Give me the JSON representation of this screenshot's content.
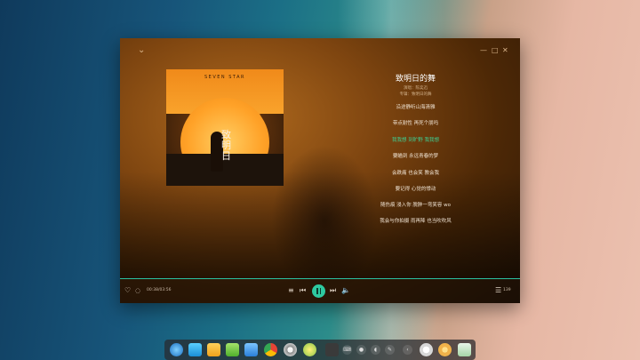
{
  "player": {
    "song_title": "致明日的舞",
    "singer": "演唱：陈奕迅",
    "album": "专辑：致明日的舞",
    "cover_text_top": "SEVEN STAR",
    "cover_text_vertical": "致明日",
    "lyrics": [
      "沿途静听山海清雅",
      "带点耐性 再死个朋吗",
      "我我想 到旷野 我我想",
      "要瞄到 永远青春的梦",
      "会跌痛 也会笑 教会我",
      "要记得 心觉的悸动",
      "随伤痕 浸入你 脱肿一弯笑容 wo",
      "我会与你拍摄 雨再降 也当吹吹风"
    ],
    "active_lyric_index": 2,
    "time": "00:38/03:56",
    "comment_count": "139"
  },
  "dock": {
    "apps": [
      "launcher-icon",
      "multitask-icon",
      "file-manager-icon",
      "app-store-icon",
      "deepin-music-icon",
      "chrome-icon",
      "settings-icon",
      "ebook-icon",
      "terminal-icon"
    ],
    "tray": [
      "keyboard-icon",
      "mic-icon",
      "volume-icon",
      "pen-icon",
      "chevron-left-icon",
      "power-icon",
      "trash-icon"
    ]
  }
}
